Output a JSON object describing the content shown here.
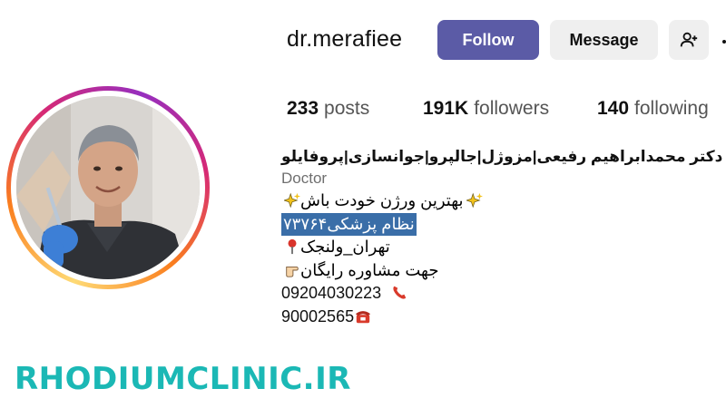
{
  "profile": {
    "username": "dr.merafiee",
    "follow_label": "Follow",
    "message_label": "Message",
    "add_user_icon": "person-plus-icon",
    "more_icon": "more-icon"
  },
  "stats": {
    "posts_count": "233",
    "posts_label": "posts",
    "followers_count": "191K",
    "followers_label": "followers",
    "following_count": "140",
    "following_label": "following"
  },
  "bio": {
    "full_name": "دکتر محمدابراهیم رفیعی|مزوژل|جالپرو|جوانسازی|پروفایلو",
    "category": "Doctor",
    "line1": "بهترین ورژن خودت باش",
    "line1_icons": [
      "sparkles-icon",
      "sparkles-icon"
    ],
    "line2": "نظام پزشکی۷۳۷۶۴",
    "line3": "تهران_ولنجک",
    "line3_icon": "pin-icon",
    "line4": "جهت مشاوره رایگان",
    "line4_icon": "pointing-hand-icon",
    "phone1": "09204030223",
    "phone1_icon": "telephone-receiver-icon",
    "phone2": "90002565",
    "phone2_icon": "telephone-icon"
  },
  "watermark": "RHODIUMCLINIC.IR",
  "colors": {
    "follow_button": "#5b5ba6",
    "secondary_button": "#efefef",
    "highlight": "#3a6ea8",
    "watermark": "#1bb8b5"
  }
}
